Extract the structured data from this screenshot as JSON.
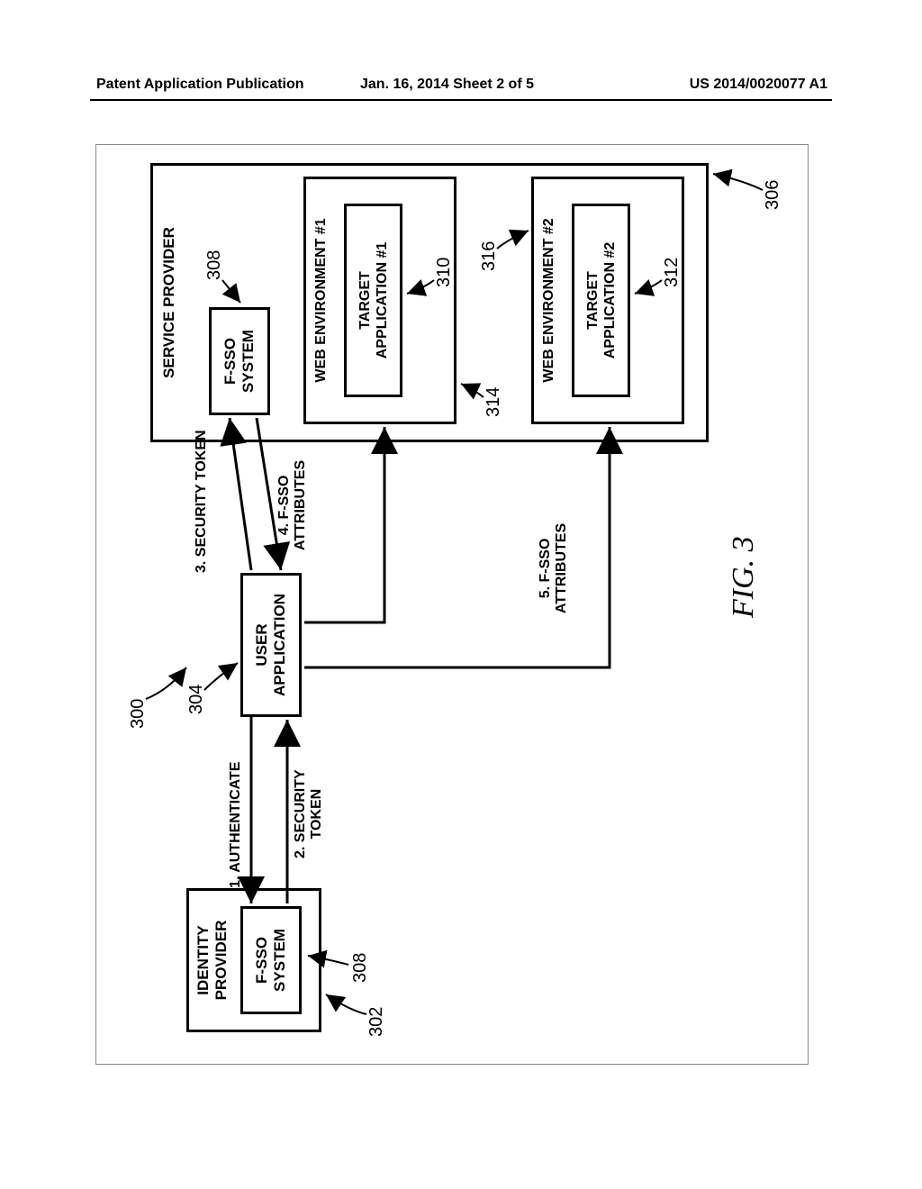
{
  "header": {
    "left": "Patent Application Publication",
    "center": "Jan. 16, 2014  Sheet 2 of 5",
    "right": "US 2014/0020077 A1"
  },
  "figure_label": "FIG. 3",
  "refs": {
    "r300": "300",
    "r302": "302",
    "r304": "304",
    "r306": "306",
    "r308a": "308",
    "r308b": "308",
    "r310": "310",
    "r312": "312",
    "r314": "314",
    "r316": "316"
  },
  "boxes": {
    "identity_provider": "IDENTITY\nPROVIDER",
    "fsso_idp": "F-SSO\nSYSTEM",
    "user_app": "USER\nAPPLICATION",
    "service_provider": "SERVICE PROVIDER",
    "fsso_sp": "F-SSO\nSYSTEM",
    "webenv1": "WEB ENVIRONMENT #1",
    "target1": "TARGET\nAPPLICATION #1",
    "webenv2": "WEB ENVIRONMENT #2",
    "target2": "TARGET\nAPPLICATION #2"
  },
  "arrows": {
    "a1": "1. AUTHENTICATE",
    "a2": "2. SECURITY\nTOKEN",
    "a3": "3. SECURITY TOKEN",
    "a4": "4. F-SSO\nATTRIBUTES",
    "a5": "5. F-SSO\nATTRIBUTES"
  }
}
